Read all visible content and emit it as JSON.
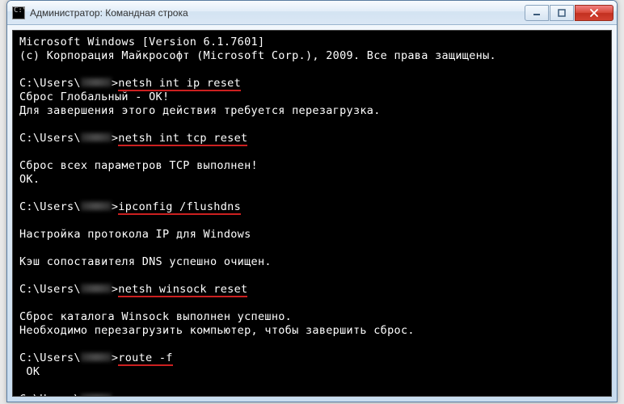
{
  "window": {
    "icon_text": "C:\\",
    "title": "Администратор: Командная строка"
  },
  "terminal": {
    "lines": [
      {
        "t": "plain",
        "text": "Microsoft Windows [Version 6.1.7601]"
      },
      {
        "t": "plain",
        "text": "(c) Корпорация Майкрософт (Microsoft Corp.), 2009. Все права защищены."
      },
      {
        "t": "blank"
      },
      {
        "t": "prompt",
        "prefix": "C:\\Users\\",
        "suffix": ">",
        "cmd": "netsh int ip reset"
      },
      {
        "t": "plain",
        "text": "Сброс Глобальный - ОК!"
      },
      {
        "t": "plain",
        "text": "Для завершения этого действия требуется перезагрузка."
      },
      {
        "t": "blank"
      },
      {
        "t": "prompt",
        "prefix": "C:\\Users\\",
        "suffix": ">",
        "cmd": "netsh int tcp reset"
      },
      {
        "t": "blank"
      },
      {
        "t": "plain",
        "text": "Сброс всех параметров TCP выполнен!"
      },
      {
        "t": "plain",
        "text": "ОК."
      },
      {
        "t": "blank"
      },
      {
        "t": "prompt",
        "prefix": "C:\\Users\\",
        "suffix": ">",
        "cmd": "ipconfig /flushdns"
      },
      {
        "t": "blank"
      },
      {
        "t": "plain",
        "text": "Настройка протокола IP для Windows"
      },
      {
        "t": "blank"
      },
      {
        "t": "plain",
        "text": "Кэш сопоставителя DNS успешно очищен."
      },
      {
        "t": "blank"
      },
      {
        "t": "prompt",
        "prefix": "C:\\Users\\",
        "suffix": ">",
        "cmd": "netsh winsock reset"
      },
      {
        "t": "blank"
      },
      {
        "t": "plain",
        "text": "Сброс каталога Winsock выполнен успешно."
      },
      {
        "t": "plain",
        "text": "Необходимо перезагрузить компьютер, чтобы завершить сброс."
      },
      {
        "t": "blank"
      },
      {
        "t": "prompt",
        "prefix": "C:\\Users\\",
        "suffix": ">",
        "cmd": "route -f"
      },
      {
        "t": "plain",
        "text": " OK"
      },
      {
        "t": "blank"
      },
      {
        "t": "prompt",
        "prefix": "C:\\Users\\",
        "suffix": ">",
        "cmd": ""
      }
    ]
  }
}
